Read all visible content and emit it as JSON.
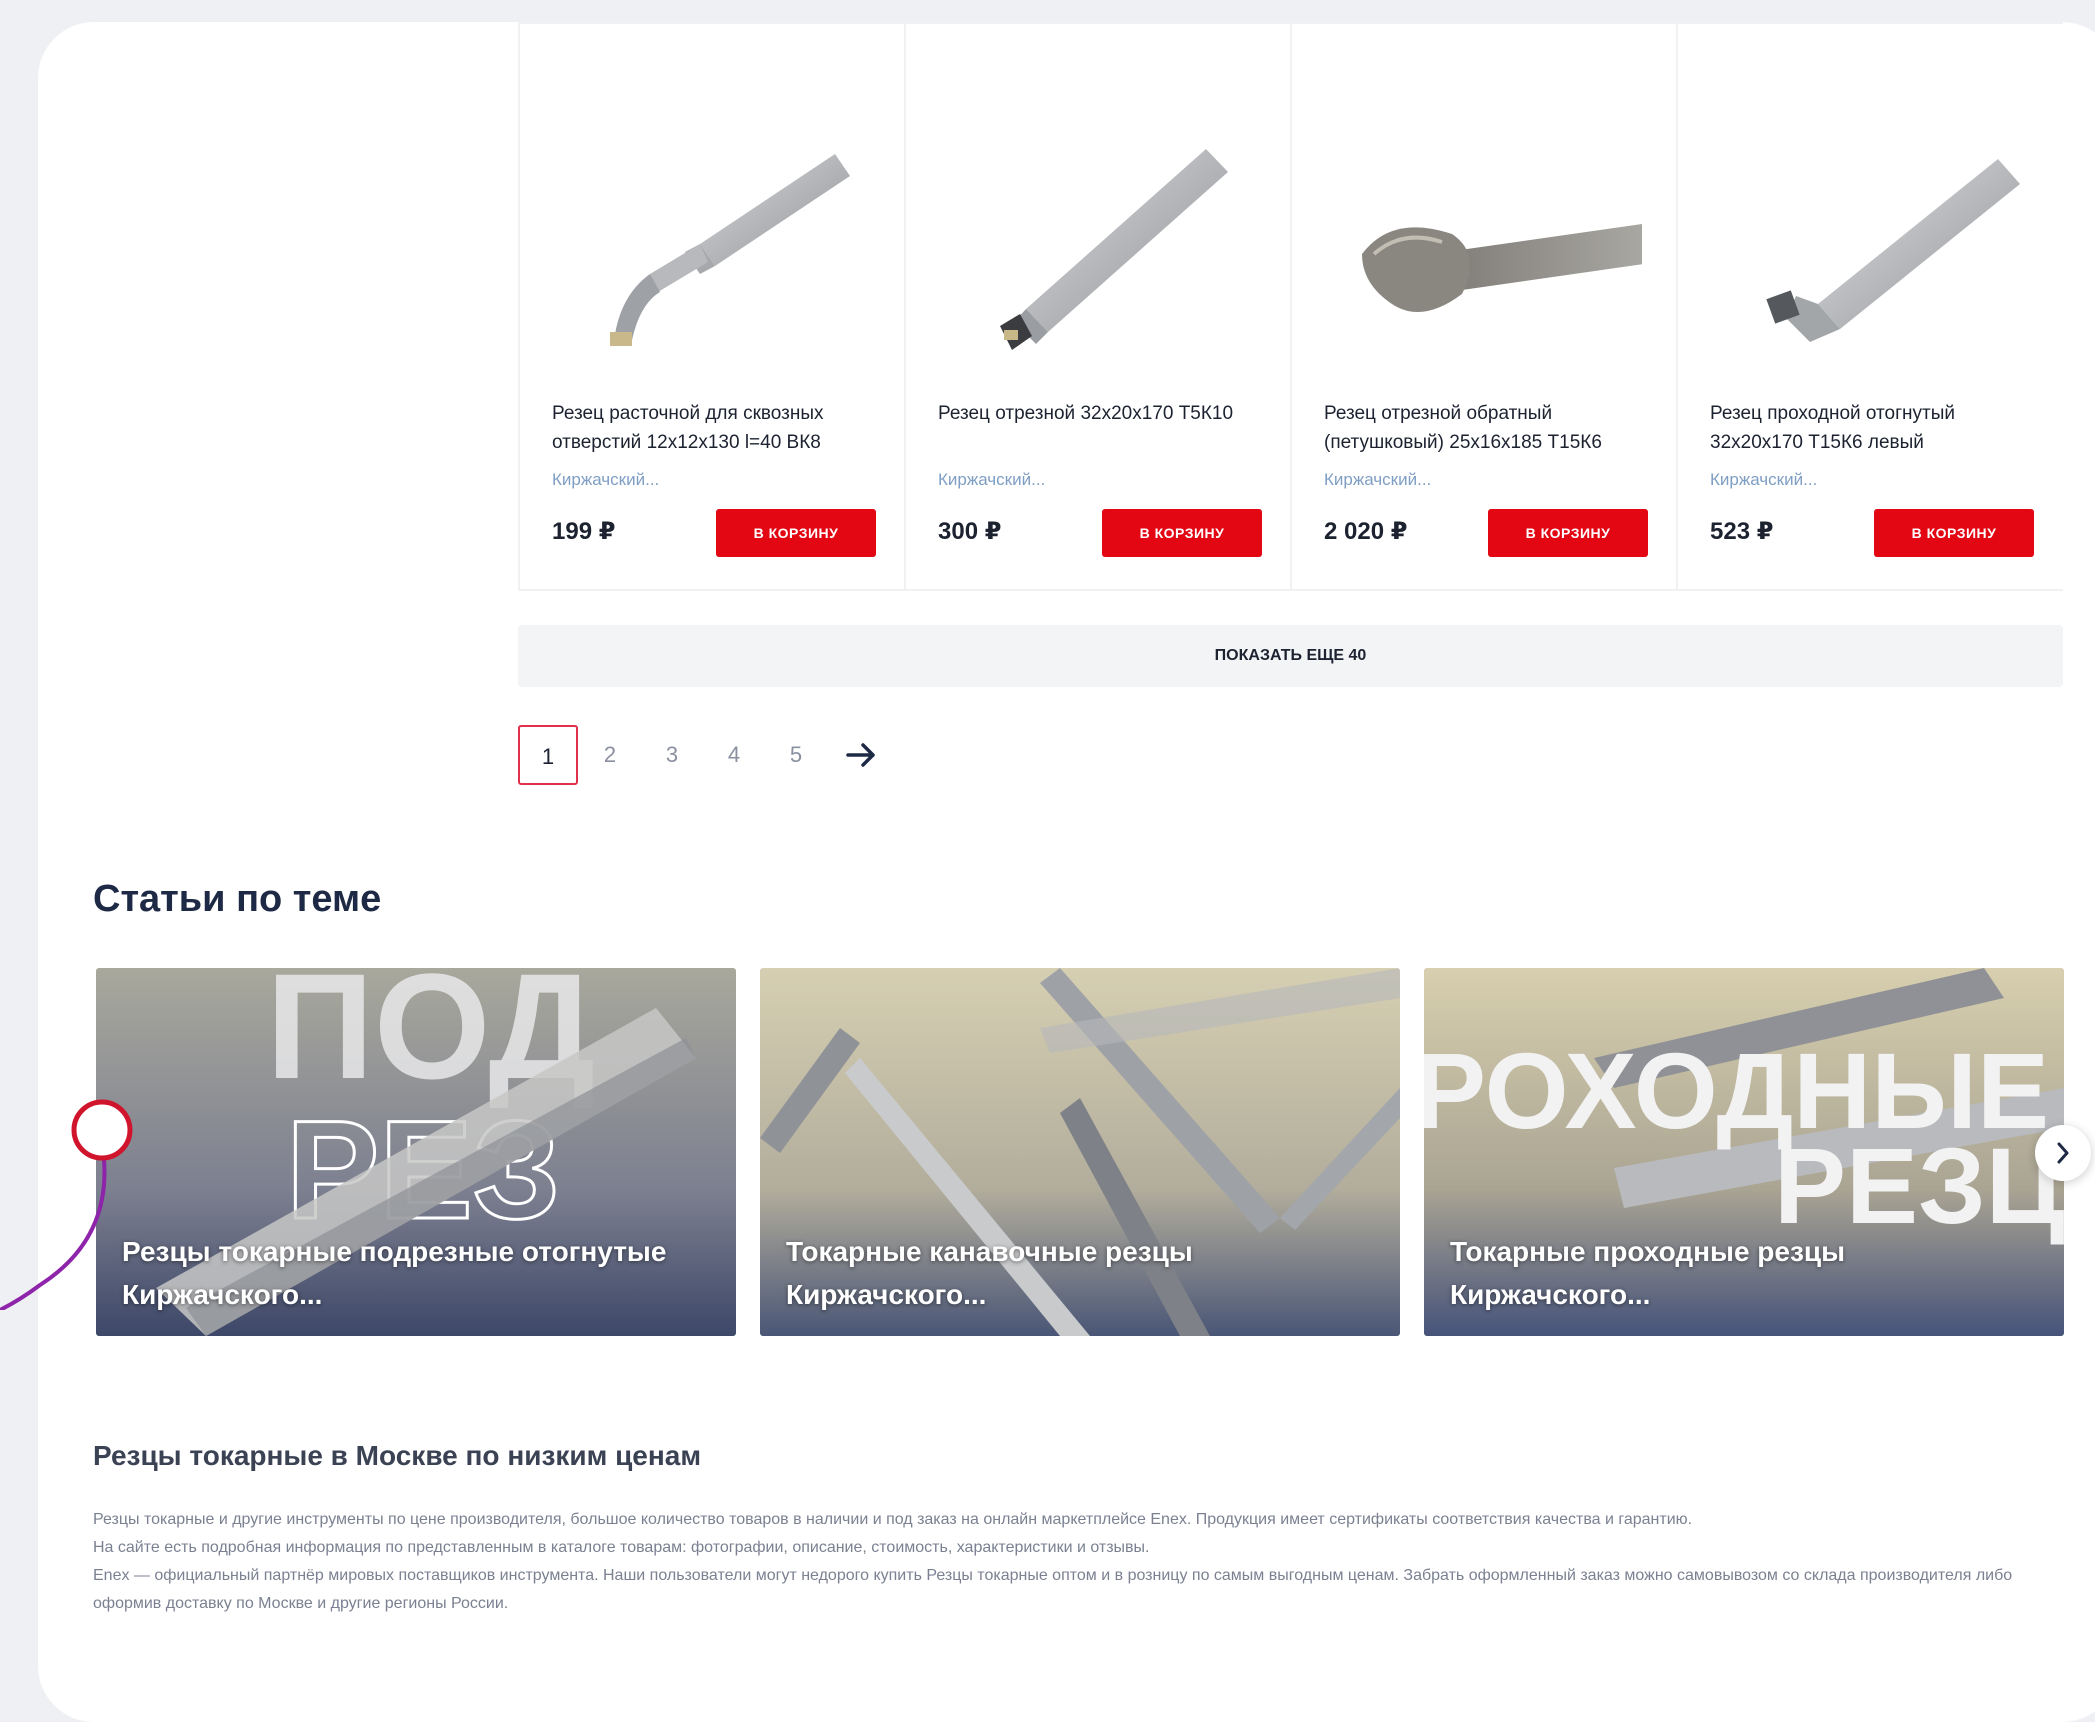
{
  "products": [
    {
      "title": "Резец расточной для сквозных отверстий 12х12х130 l=40 ВК8",
      "brand": "Киржачский...",
      "price": "199 ₽",
      "cart_label": "В КОРЗИНУ",
      "image_icon": "boring-tool-image"
    },
    {
      "title": "Резец отрезной 32х20х170 Т5К10",
      "brand": "Киржачский...",
      "price": "300 ₽",
      "cart_label": "В КОРЗИНУ",
      "image_icon": "cutoff-tool-image"
    },
    {
      "title": "Резец отрезной обратный (петушковый) 25х16х185 Т15К6",
      "brand": "Киржачский...",
      "price": "2 020 ₽",
      "cart_label": "В КОРЗИНУ",
      "image_icon": "reverse-cutoff-tool-image"
    },
    {
      "title": "Резец проходной отогнутый 32х20х170 Т15К6 левый",
      "brand": "Киржачский...",
      "price": "523 ₽",
      "cart_label": "В КОРЗИНУ",
      "image_icon": "bent-turning-tool-image"
    }
  ],
  "show_more_label": "ПОКАЗАТЬ ЕЩЕ 40",
  "pagination": {
    "pages": [
      "1",
      "2",
      "3",
      "4",
      "5"
    ],
    "current": "1",
    "next_icon": "arrow-right-icon"
  },
  "articles": {
    "title": "Статьи по теме",
    "items": [
      {
        "caption": "Резцы токарные подрезные отогнутые Киржачского...",
        "bg_text_1": "ПОД",
        "bg_text_2": "РЕЗ"
      },
      {
        "caption": "Токарные канавочные резцы Киржачского..."
      },
      {
        "caption": "Токарные проходные резцы Киржачского...",
        "bg_text_1": "РОХОДНЫЕ",
        "bg_text_2": "РЕЗЦ"
      }
    ],
    "next_icon": "chevron-right-icon"
  },
  "seo": {
    "title": "Резцы токарные в Москве по низким ценам",
    "paragraphs": [
      "Резцы токарные и другие инструменты по цене производителя, большое количество товаров в наличии и под заказ на онлайн маркетплейсе Enex. Продукция имеет сертификаты соответствия качества и гарантию.",
      "На сайте есть подробная информация по представленным в каталоге товарам: фотографии, описание, стоимость, характеристики и отзывы.",
      "Enex — официальный партнёр мировых поставщиков инструмента. Наши пользователи могут недорого купить Резцы токарные оптом и в розницу по самым выгодным ценам. Забрать оформленный заказ можно самовывозом со склада производителя либо оформив доставку по Москве и другие регионы России."
    ]
  },
  "colors": {
    "accent": "#e30613",
    "brand_link": "#7e9ec4",
    "heading": "#1e2a45",
    "annotation": "#8e24aa"
  }
}
